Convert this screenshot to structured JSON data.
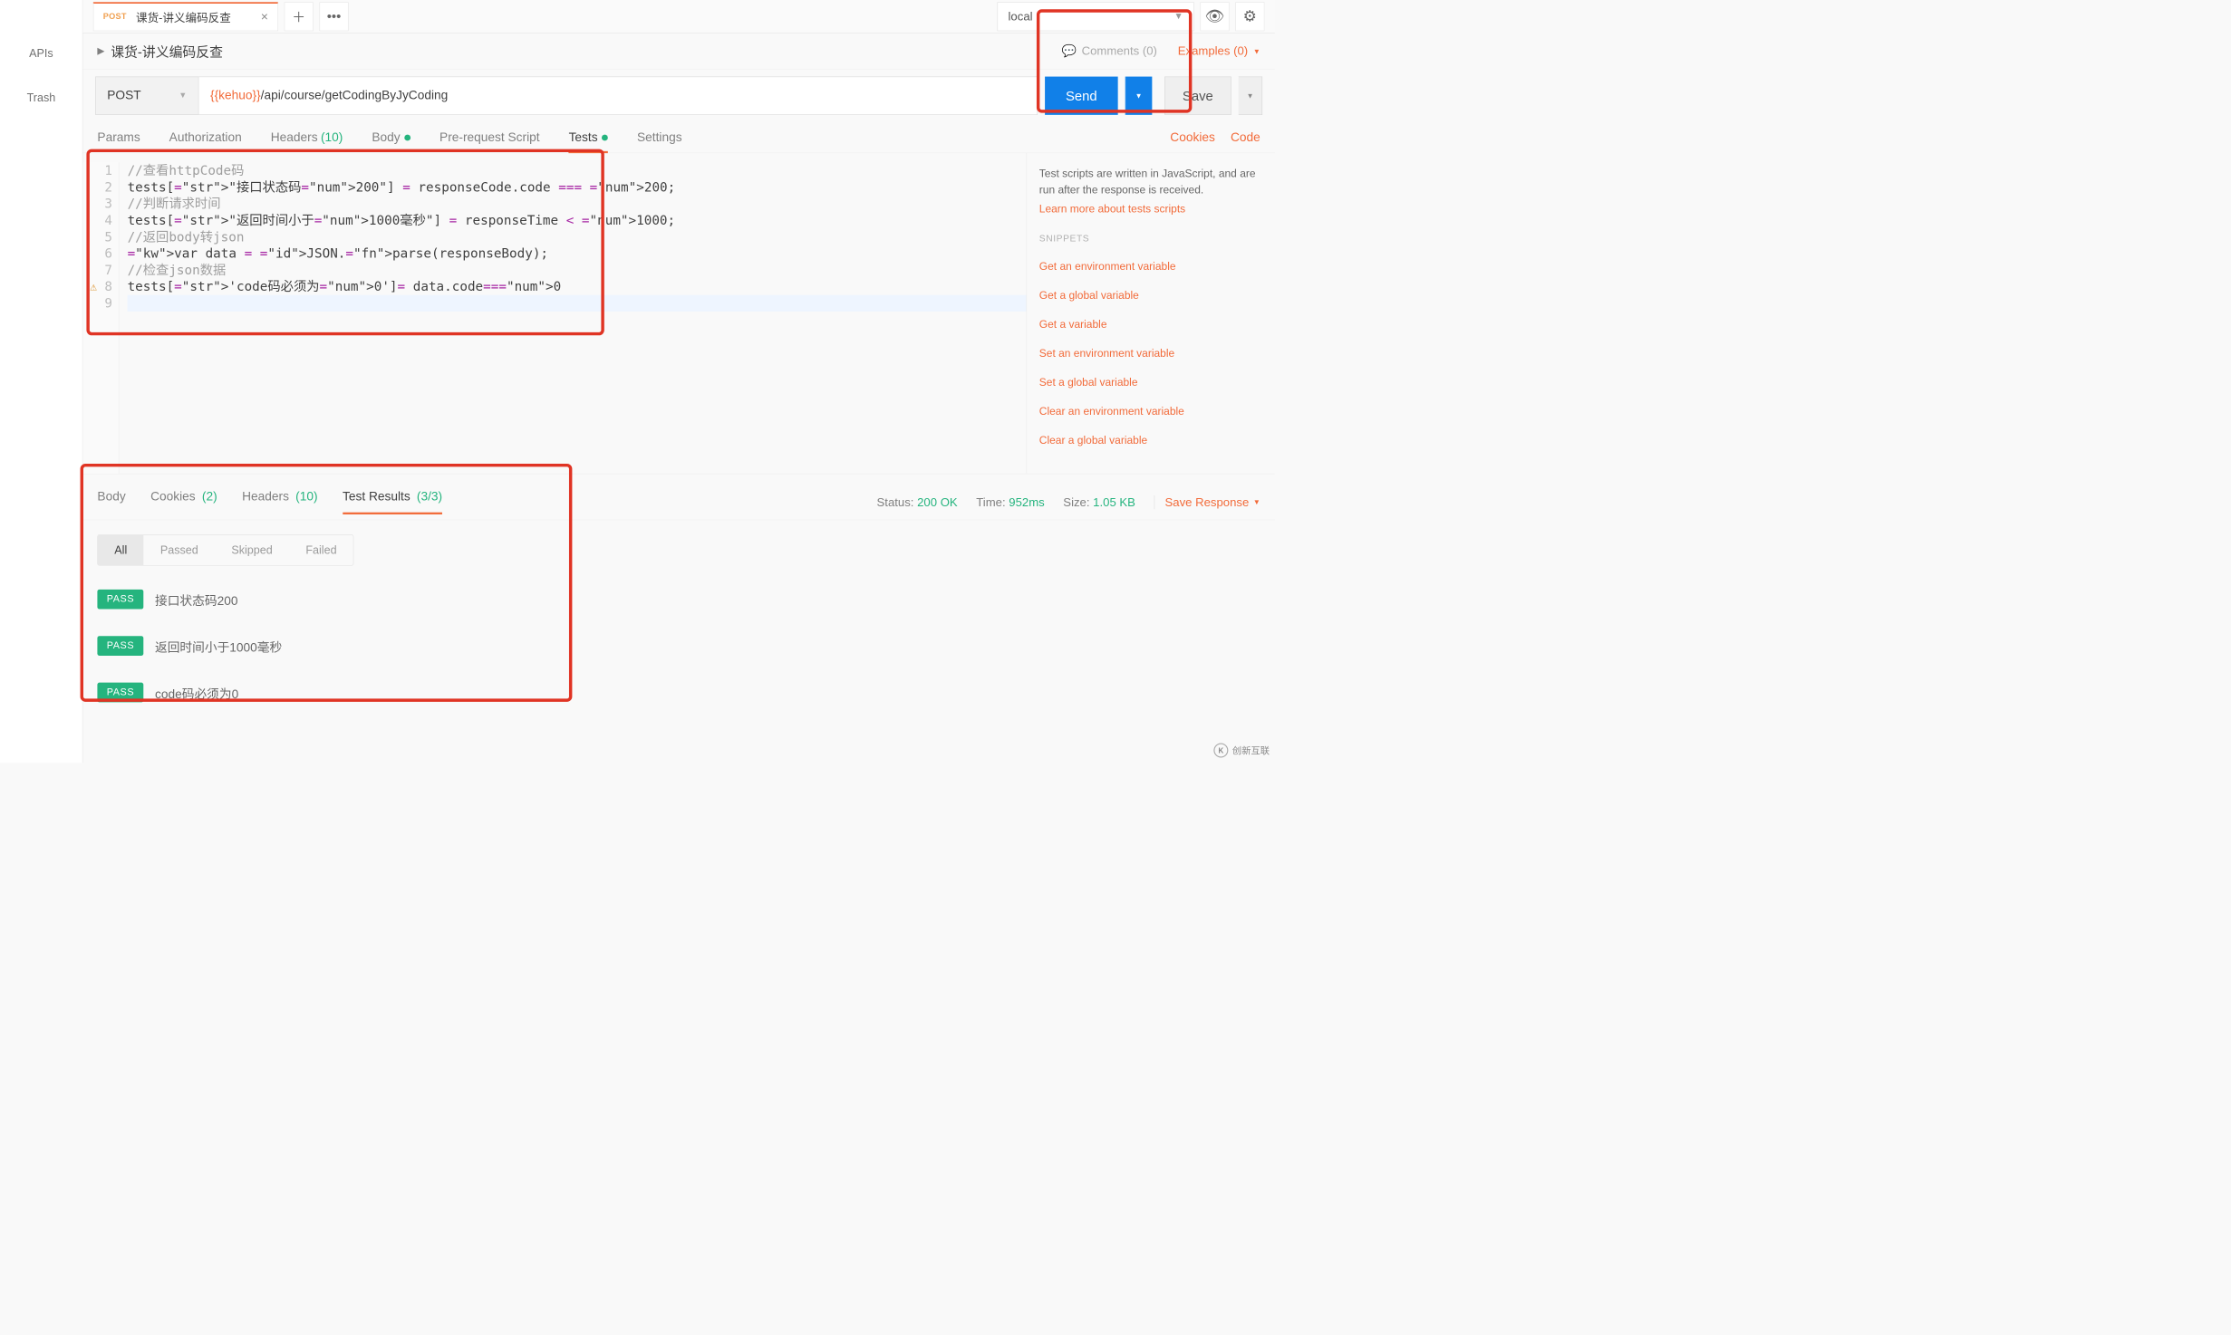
{
  "sidebar": {
    "items": [
      {
        "label": "APIs"
      },
      {
        "label": "Trash"
      }
    ]
  },
  "tabbar": {
    "tab": {
      "method": "POST",
      "title": "课货-讲义编码反查"
    },
    "env": "local"
  },
  "request": {
    "title": "课货-讲义编码反查",
    "comments_label": "Comments (0)",
    "examples_label": "Examples (0)",
    "method": "POST",
    "url_var": "{{kehuo}}",
    "url_path": "/api/course/getCodingByJyCoding",
    "send_label": "Send",
    "save_label": "Save"
  },
  "req_tabs": {
    "params": "Params",
    "authorization": "Authorization",
    "headers": "Headers",
    "headers_count": "(10)",
    "body": "Body",
    "prerequest": "Pre-request Script",
    "tests": "Tests",
    "settings": "Settings",
    "cookies": "Cookies",
    "code": "Code"
  },
  "editor": {
    "lines": [
      {
        "n": 1,
        "raw": "//查看httpCode码",
        "type": "comment"
      },
      {
        "n": 2,
        "raw": "tests[\"接口状态码200\"] = responseCode.code === 200;"
      },
      {
        "n": 3,
        "raw": "//判断请求时间",
        "type": "comment"
      },
      {
        "n": 4,
        "raw": "tests[\"返回时间小于1000毫秒\"] = responseTime < 1000;"
      },
      {
        "n": 5,
        "raw": "//返回body转json",
        "type": "comment"
      },
      {
        "n": 6,
        "raw": "var data = JSON.parse(responseBody);"
      },
      {
        "n": 7,
        "raw": "//检查json数据",
        "type": "comment"
      },
      {
        "n": 8,
        "raw": "tests['code码必须为0']= data.code==0",
        "warn": true
      },
      {
        "n": 9,
        "raw": "",
        "highlight": true
      }
    ]
  },
  "snippets": {
    "desc1": "Test scripts are written in JavaScript, and are run after the response is received.",
    "learn_more": "Learn more about tests scripts",
    "header": "SNIPPETS",
    "list": [
      "Get an environment variable",
      "Get a global variable",
      "Get a variable",
      "Set an environment variable",
      "Set a global variable",
      "Clear an environment variable",
      "Clear a global variable"
    ]
  },
  "response": {
    "tabs": {
      "body": "Body",
      "cookies": "Cookies",
      "cookies_count": "(2)",
      "headers": "Headers",
      "headers_count": "(10)",
      "test_results": "Test Results",
      "test_results_count": "(3/3)"
    },
    "status_label": "Status:",
    "status_value": "200 OK",
    "time_label": "Time:",
    "time_value": "952ms",
    "size_label": "Size:",
    "size_value": "1.05 KB",
    "save_response": "Save Response"
  },
  "filters": {
    "all": "All",
    "passed": "Passed",
    "skipped": "Skipped",
    "failed": "Failed"
  },
  "results": [
    {
      "status": "PASS",
      "name": "接口状态码200"
    },
    {
      "status": "PASS",
      "name": "返回时间小于1000毫秒"
    },
    {
      "status": "PASS",
      "name": "code码必须为0"
    }
  ],
  "watermark": "创新互联"
}
